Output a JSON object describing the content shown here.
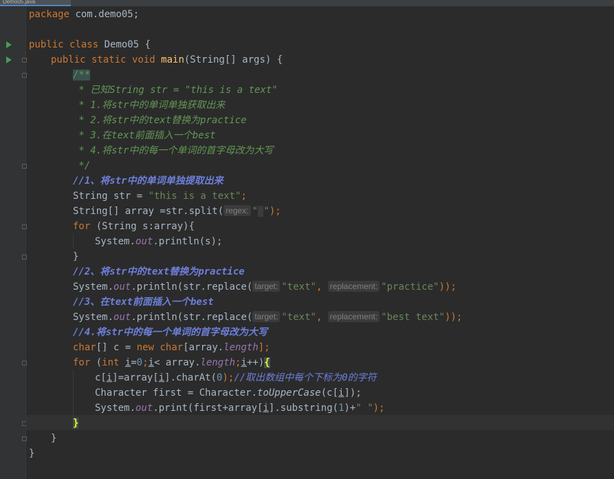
{
  "tab": {
    "title": "Demo05.java"
  },
  "code": {
    "l1": {
      "kw": "package",
      "rest": " com.demo05;"
    },
    "l3": {
      "kw": "public class",
      "rest": " Demo05 {"
    },
    "l4": {
      "kw": "public static void",
      "fn": "main",
      "rest": "(String[] args) {"
    },
    "l5": "/**",
    "l6": " * 已知String str = \"this is a text\"",
    "l7": " * 1.将str中的单词单独获取出来",
    "l8": " * 2.将str中的text替换为practice",
    "l9": " * 3.在text前面插入一个best",
    "l10": " * 4.将str中的每一个单词的首字母改为大写",
    "l11": " */",
    "l12": "//1、将str中的单词单独提取出来",
    "l13": {
      "a": "String str = ",
      "s": "\"this is a text\"",
      "b": ";"
    },
    "l14": {
      "a": "String[] array =str.split(",
      "hint": "regex:",
      "s1": "\"",
      "s2": " ",
      "s3": "\"",
      "b": ");"
    },
    "l15": {
      "kw": "for",
      "rest": " (String s:array){"
    },
    "l16": {
      "a": "System.",
      "st": "out",
      "b": ".println(s);"
    },
    "l17": "}",
    "l18": "//2、将str中的text替换为practice",
    "l19": {
      "a": "System.",
      "st": "out",
      "b": ".println(str.replace(",
      "h1": "target:",
      "s1": "\"text\"",
      "c": ", ",
      "h2": "replacement:",
      "s2": "\"practice\"",
      "d": "));"
    },
    "l20": "//3、在text前面插入一个best",
    "l21": {
      "a": "System.",
      "st": "out",
      "b": ".println(str.replace(",
      "h1": "target:",
      "s1": "\"text\"",
      "c": ", ",
      "h2": "replacement:",
      "s2": "\"best text\"",
      "d": "));"
    },
    "l22": "//4.将str中的每一个单词的首字母改为大写",
    "l23": {
      "kw1": "char",
      "a": "[] c = ",
      "kw2": "new",
      "kw3": " char",
      "b": "[array.",
      "st": "length",
      "c": "];"
    },
    "l24": {
      "kw1": "for",
      "a": " (",
      "kw2": "int",
      "sp": " ",
      "i1": "i",
      "b": "=",
      "n0": "0",
      "c": ";",
      "i2": "i",
      "d": "< array.",
      "st": "length",
      "e": ";",
      "i3": "i",
      "f": "++)",
      "brace": "{"
    },
    "l25": {
      "a": "c[",
      "i1": "i",
      "b": "]=array[",
      "i2": "i",
      "c": "].charAt(",
      "n0": "0",
      "d": ");",
      "cm": "//取出数组中每个下标为0的字符"
    },
    "l26": {
      "a": "Character first = Character.",
      "sm": "toUpperCase",
      "b": "(c[",
      "i1": "i",
      "c": "]);"
    },
    "l27": {
      "a": "System.",
      "st": "out",
      "b": ".print(first+array[",
      "i1": "i",
      "c": "].substring(",
      "n1": "1",
      "d": ")+",
      "s": "\" \"",
      "e": ");"
    },
    "l28": "}",
    "l29": "}",
    "l30": "}"
  }
}
